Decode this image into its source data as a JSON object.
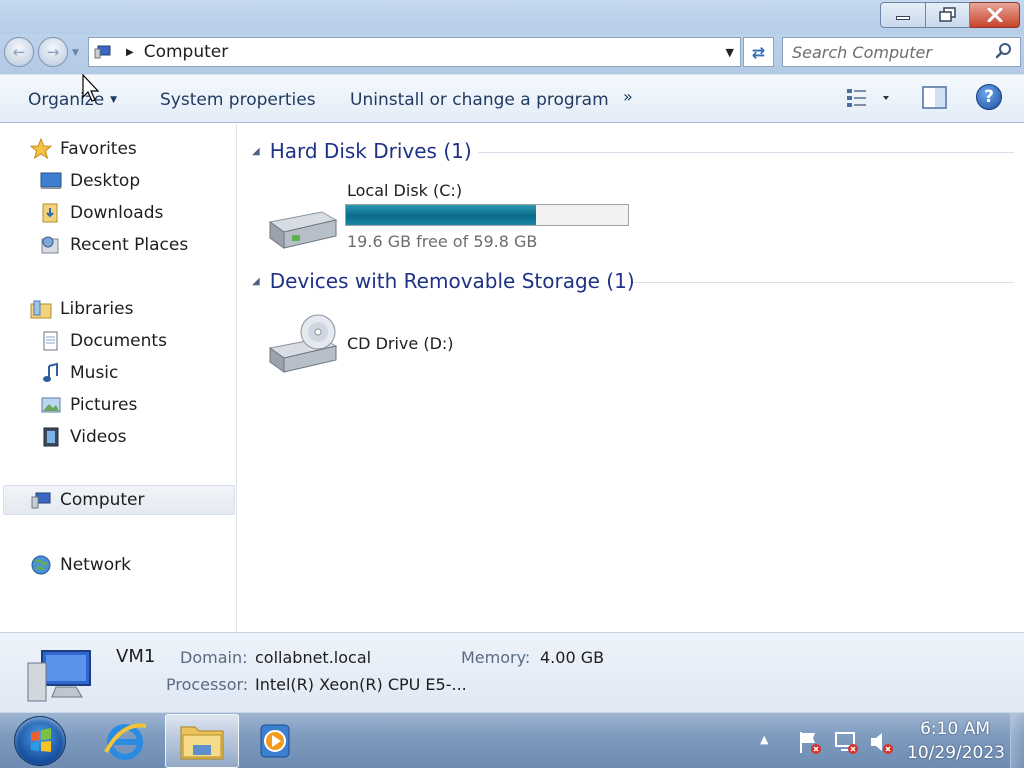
{
  "window": {
    "minimize_icon": "minimize-icon",
    "maximize_icon": "restore-icon",
    "close_icon": "close-icon"
  },
  "address_bar": {
    "path_label": "Computer",
    "search_placeholder": "Search Computer"
  },
  "toolbar": {
    "organize_label": "Organize",
    "system_properties_label": "System properties",
    "uninstall_label": "Uninstall or change a program",
    "more_label": "»"
  },
  "navigation": {
    "favorites_label": "Favorites",
    "desktop_label": "Desktop",
    "downloads_label": "Downloads",
    "recent_places_label": "Recent Places",
    "libraries_label": "Libraries",
    "documents_label": "Documents",
    "music_label": "Music",
    "pictures_label": "Pictures",
    "videos_label": "Videos",
    "computer_label": "Computer",
    "network_label": "Network"
  },
  "content": {
    "hard_disk_group": {
      "title": "Hard Disk Drives (1)",
      "drive_name": "Local Disk (C:)",
      "free_text": "19.6 GB free of 59.8 GB",
      "used_fraction": 0.672
    },
    "removable_group": {
      "title": "Devices with Removable Storage (1)",
      "drive_name": "CD Drive (D:)"
    }
  },
  "details": {
    "computer_name": "VM1",
    "domain_label": "Domain:",
    "domain_value": "collabnet.local",
    "memory_label": "Memory:",
    "memory_value": "4.00 GB",
    "processor_label": "Processor:",
    "processor_value": "Intel(R) Xeon(R) CPU E5-..."
  },
  "taskbar": {
    "time": "6:10 AM",
    "date": "10/29/2023"
  },
  "colors": {
    "usage_bar": "#0a6a8a",
    "group_header": "#1e3287",
    "close_button": "#c7432b"
  }
}
